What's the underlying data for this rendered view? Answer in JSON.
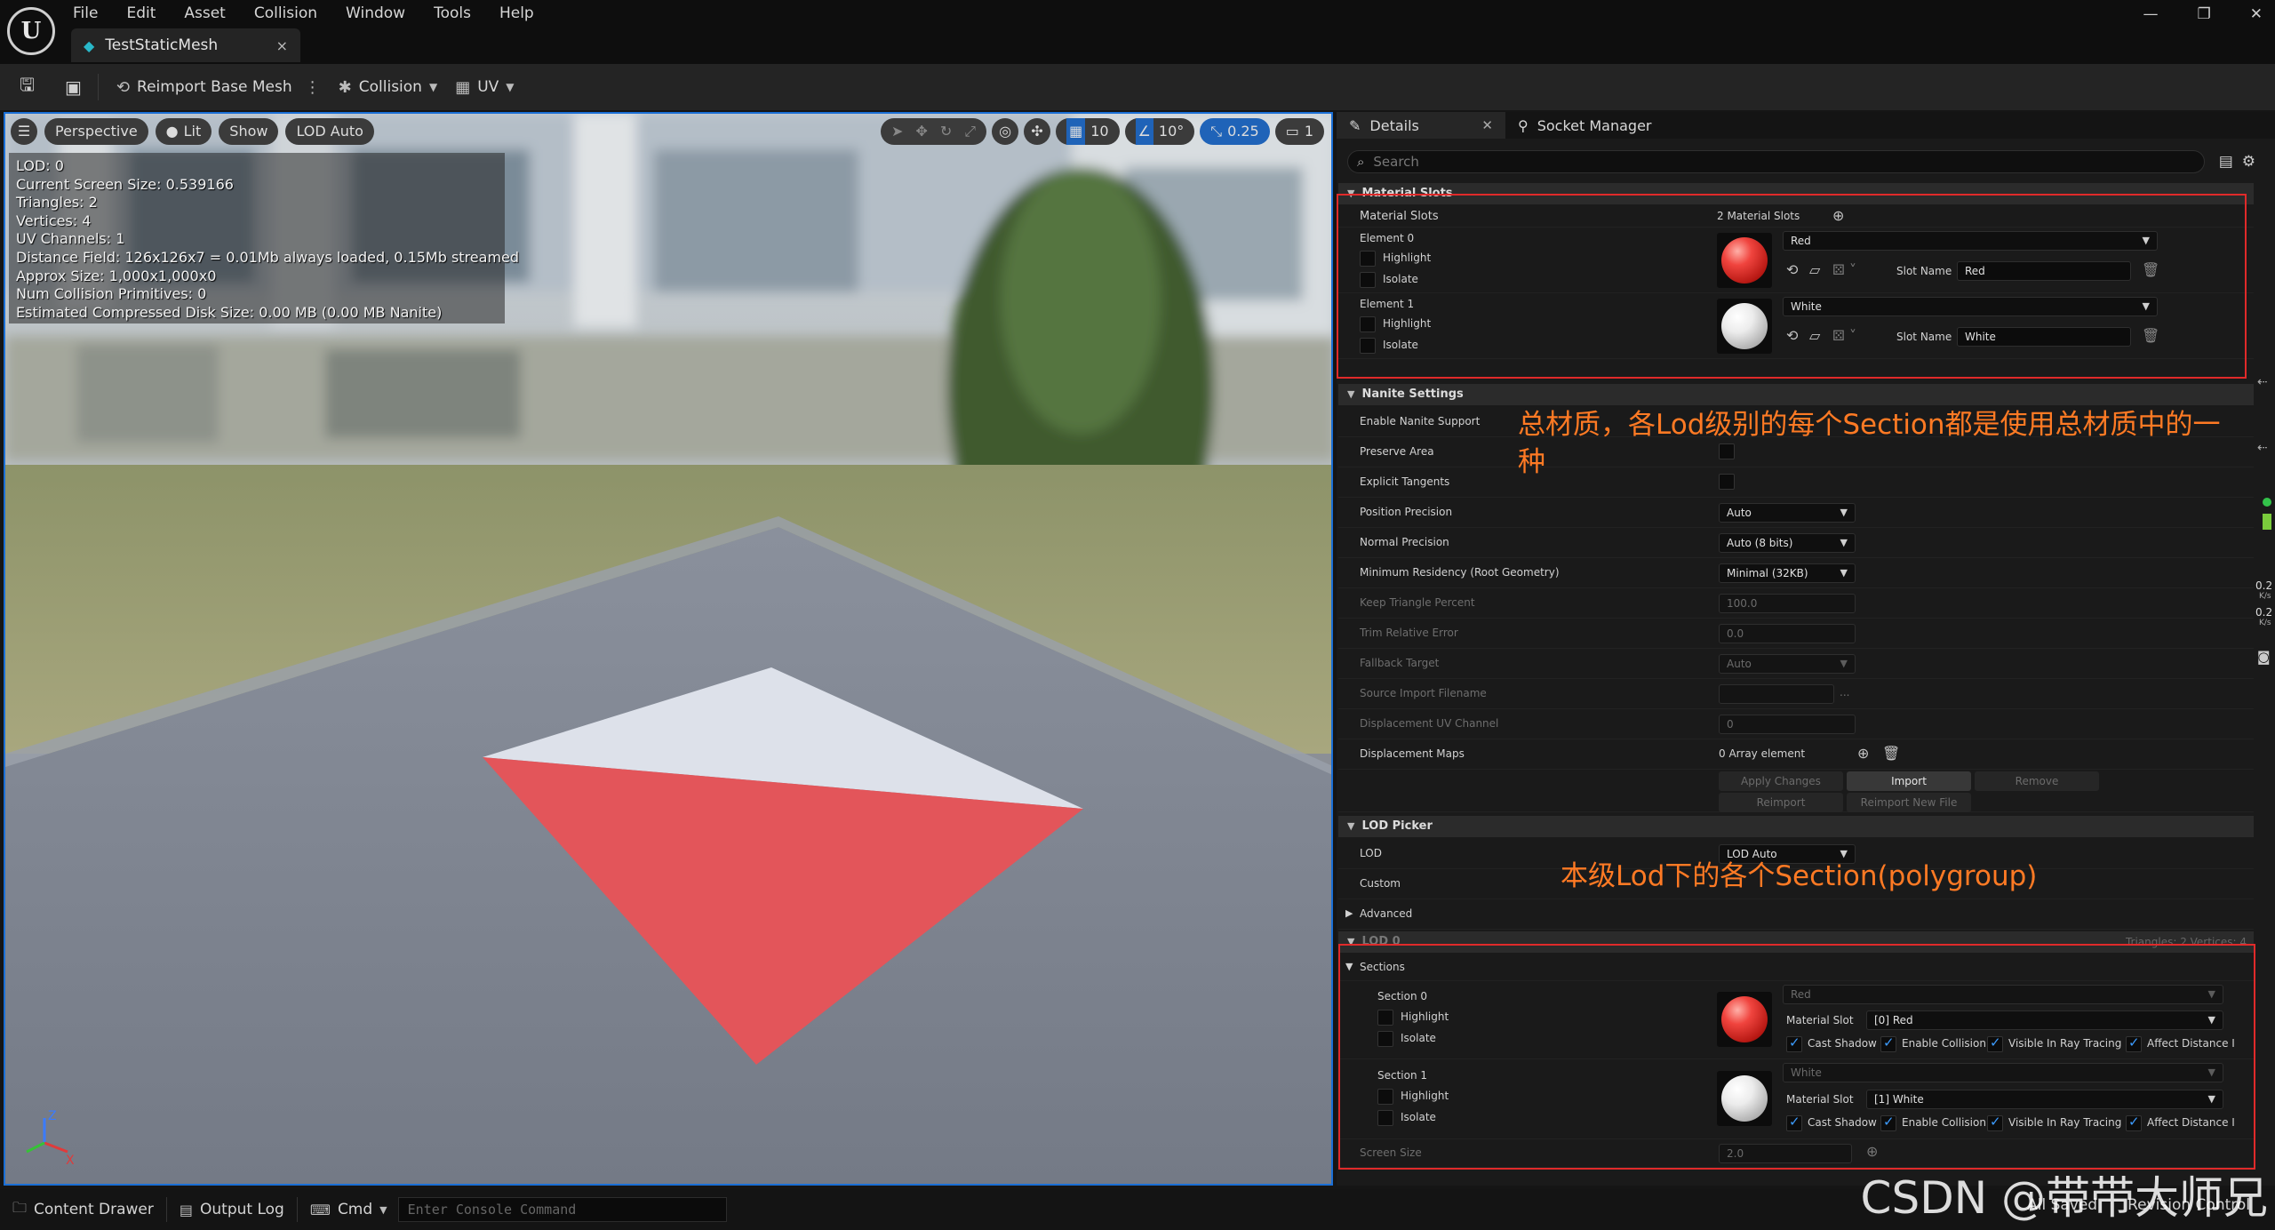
{
  "menu": [
    "File",
    "Edit",
    "Asset",
    "Collision",
    "Window",
    "Tools",
    "Help"
  ],
  "doc_tab": {
    "title": "TestStaticMesh",
    "close": "×"
  },
  "window_controls": [
    "—",
    "❐",
    "✕"
  ],
  "toolbar": {
    "reimport": "Reimport Base Mesh",
    "collision": "Collision",
    "uv": "UV"
  },
  "viewport": {
    "perspective": "Perspective",
    "lit": "Lit",
    "show": "Show",
    "lod_auto": "LOD Auto",
    "grid_snap": "10",
    "rot_snap": "10°",
    "scale_snap": "0.25",
    "camera_speed": "1",
    "stats": [
      "LOD:  0",
      "Current Screen Size:  0.539166",
      "Triangles:  2",
      "Vertices:  4",
      "UV Channels:  1",
      "Distance Field:  126x126x7 = 0.01Mb always loaded, 0.15Mb streamed",
      "Approx Size: 1,000x1,000x0",
      "Num Collision Primitives:  0",
      "Estimated Compressed Disk Size: 0.00 MB (0.00 MB Nanite)"
    ],
    "axis": {
      "z": "Z",
      "x": "X"
    }
  },
  "details": {
    "tab_details": "Details",
    "tab_socket": "Socket Manager",
    "search_placeholder": "Search",
    "material_slots": {
      "header": "Material Slots",
      "label": "Material Slots",
      "count": "2 Material Slots",
      "slot_name_label": "Slot Name",
      "highlight": "Highlight",
      "isolate": "Isolate",
      "elements": [
        {
          "label": "Element 0",
          "material": "Red",
          "slot_name": "Red"
        },
        {
          "label": "Element 1",
          "material": "White",
          "slot_name": "White"
        }
      ]
    },
    "nanite": {
      "header": "Nanite Settings",
      "enable": "Enable Nanite Support",
      "preserve_area": "Preserve Area",
      "explicit_tangents": "Explicit Tangents",
      "position_precision": "Position Precision",
      "position_precision_value": "Auto",
      "normal_precision": "Normal Precision",
      "normal_precision_value": "Auto (8 bits)",
      "min_residency": "Minimum Residency (Root Geometry)",
      "min_residency_value": "Minimal (32KB)",
      "keep_triangle": "Keep Triangle Percent",
      "keep_triangle_value": "100.0",
      "trim_error": "Trim Relative Error",
      "trim_error_value": "0.0",
      "fallback_target": "Fallback Target",
      "fallback_target_value": "Auto",
      "source_import": "Source Import Filename",
      "source_import_more": "...",
      "displacement_uv": "Displacement UV Channel",
      "displacement_uv_value": "0",
      "displacement_maps": "Displacement Maps",
      "displacement_maps_value": "0 Array element",
      "apply_changes": "Apply Changes",
      "import": "Import",
      "remove": "Remove",
      "reimport": "Reimport",
      "reimport_new": "Reimport New File"
    },
    "lod_picker": {
      "header": "LOD Picker",
      "lod": "LOD",
      "lod_value": "LOD Auto",
      "custom": "Custom",
      "advanced": "Advanced"
    },
    "lod0": {
      "header": "LOD 0",
      "info": "Triangles: 2   Vertices: 4",
      "sections_header": "Sections",
      "material_slot_label": "Material Slot",
      "highlight": "Highlight",
      "isolate": "Isolate",
      "cast_shadow": "Cast Shadow",
      "enable_collision": "Enable Collision",
      "visible_rt": "Visible In Ray Tracing",
      "affect_distance": "Affect Distance I",
      "sections": [
        {
          "label": "Section 0",
          "material": "Red",
          "slot": "[0] Red"
        },
        {
          "label": "Section 1",
          "material": "White",
          "slot": "[1] White"
        }
      ],
      "screen_size": "Screen Size",
      "screen_size_value": "2.0"
    },
    "side_readouts": [
      "0.2",
      "K/s",
      "0.2",
      "K/s"
    ]
  },
  "annotations": {
    "top": "总材质，各Lod级别的每个Section都是使用总材质中的一",
    "top_line2": "种",
    "bottom": "本级Lod下的各个Section(polygroup)",
    "box_color": "#e02a2a",
    "text_color": "#ff7a24"
  },
  "statusbar": {
    "content_drawer": "Content Drawer",
    "output_log": "Output Log",
    "cmd": "Cmd",
    "console_placeholder": "Enter Console Command",
    "all_saved": "All Saved",
    "revision_control": "Revision Control"
  },
  "watermark": "CSDN @带带大师兄"
}
